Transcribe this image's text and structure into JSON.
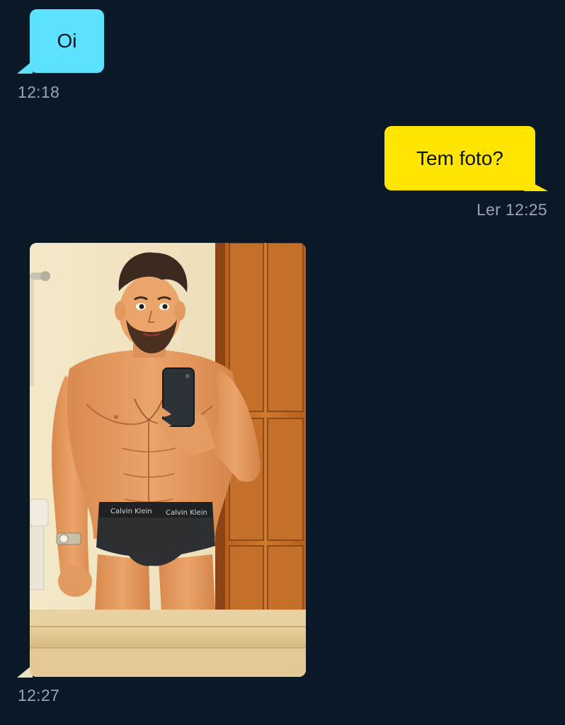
{
  "conversation": {
    "messages": [
      {
        "direction": "incoming",
        "type": "text",
        "text": "Oi",
        "time": "12:18",
        "bubble_color": "#5ce1ff"
      },
      {
        "direction": "outgoing",
        "type": "text",
        "text": "Tem foto?",
        "status": "Ler",
        "time": "12:25",
        "bubble_color": "#ffe500"
      },
      {
        "direction": "incoming",
        "type": "image",
        "image_subject": "illustrated mirror selfie of a shirtless bearded man in a bathroom, holding a phone",
        "waistband_text": "Calvin Klein",
        "time": "12:27",
        "bubble_color": "#ece1c3"
      }
    ]
  },
  "colors": {
    "background": "#0b1826",
    "timestamp": "#9aa4b2",
    "incoming_bubble": "#5ce1ff",
    "outgoing_bubble": "#ffe500"
  }
}
